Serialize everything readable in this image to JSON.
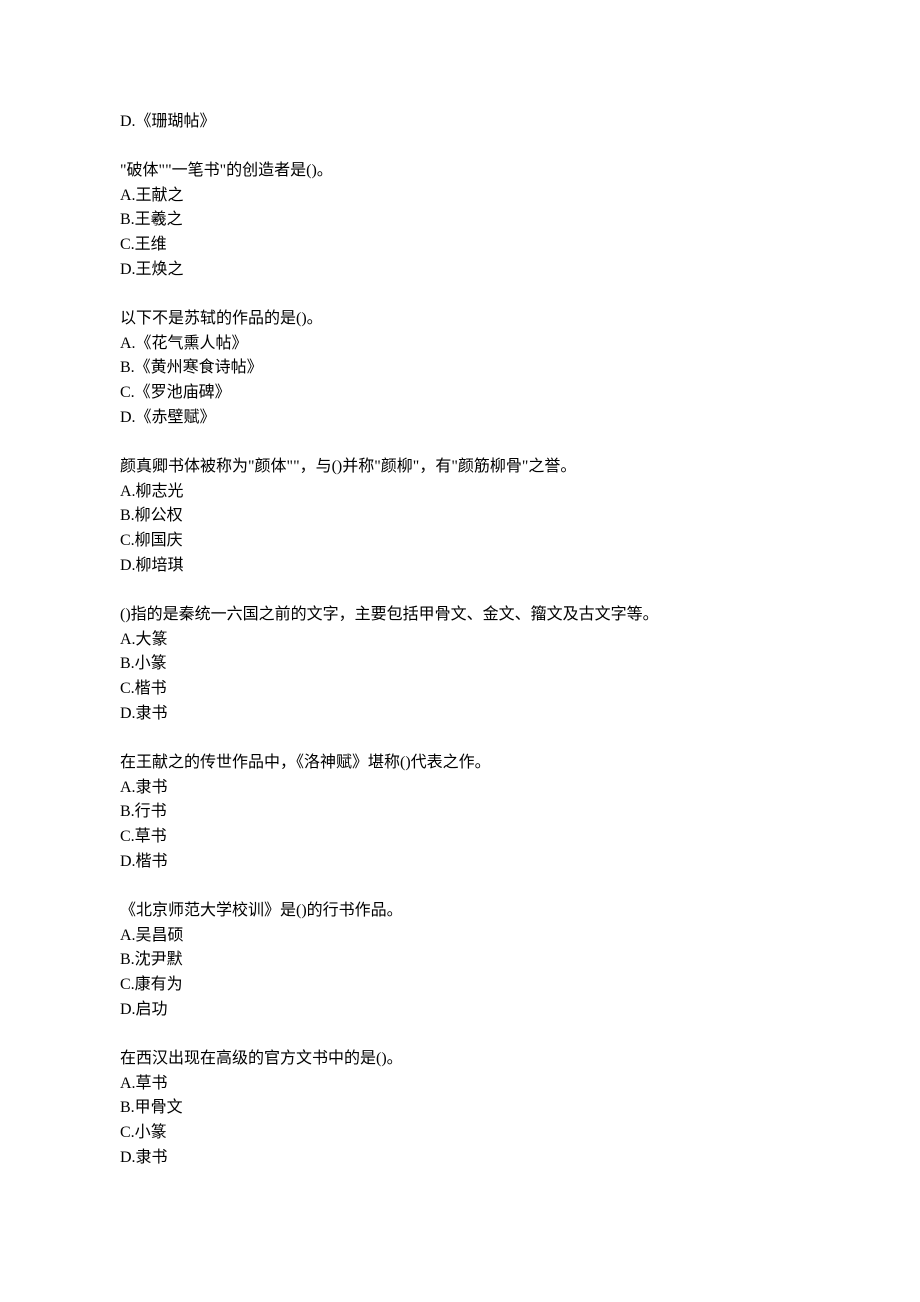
{
  "orphan_option": "D.《珊瑚帖》",
  "questions": [
    {
      "stem": "\"破体\"\"一笔书\"的创造者是()。",
      "options": [
        "A.王献之",
        "B.王羲之",
        "C.王维",
        "D.王焕之"
      ]
    },
    {
      "stem": "以下不是苏轼的作品的是()。",
      "options": [
        "A.《花气熏人帖》",
        "B.《黄州寒食诗帖》",
        "C.《罗池庙碑》",
        "D.《赤壁赋》"
      ]
    },
    {
      "stem": "颜真卿书体被称为\"颜体\"\"，与()并称\"颜柳\"，有\"颜筋柳骨\"之誉。",
      "options": [
        "A.柳志光",
        "B.柳公权",
        "C.柳国庆",
        "D.柳培琪"
      ]
    },
    {
      "stem": "()指的是秦统一六国之前的文字，主要包括甲骨文、金文、籀文及古文字等。",
      "options": [
        "A.大篆",
        "B.小篆",
        "C.楷书",
        "D.隶书"
      ]
    },
    {
      "stem": "在王献之的传世作品中，《洛神赋》堪称()代表之作。",
      "options": [
        "A.隶书",
        "B.行书",
        "C.草书",
        "D.楷书"
      ]
    },
    {
      "stem": "《北京师范大学校训》是()的行书作品。",
      "options": [
        "A.吴昌硕",
        "B.沈尹默",
        "C.康有为",
        "D.启功"
      ]
    },
    {
      "stem": "在西汉出现在高级的官方文书中的是()。",
      "options": [
        "A.草书",
        "B.甲骨文",
        "C.小篆",
        "D.隶书"
      ]
    }
  ]
}
